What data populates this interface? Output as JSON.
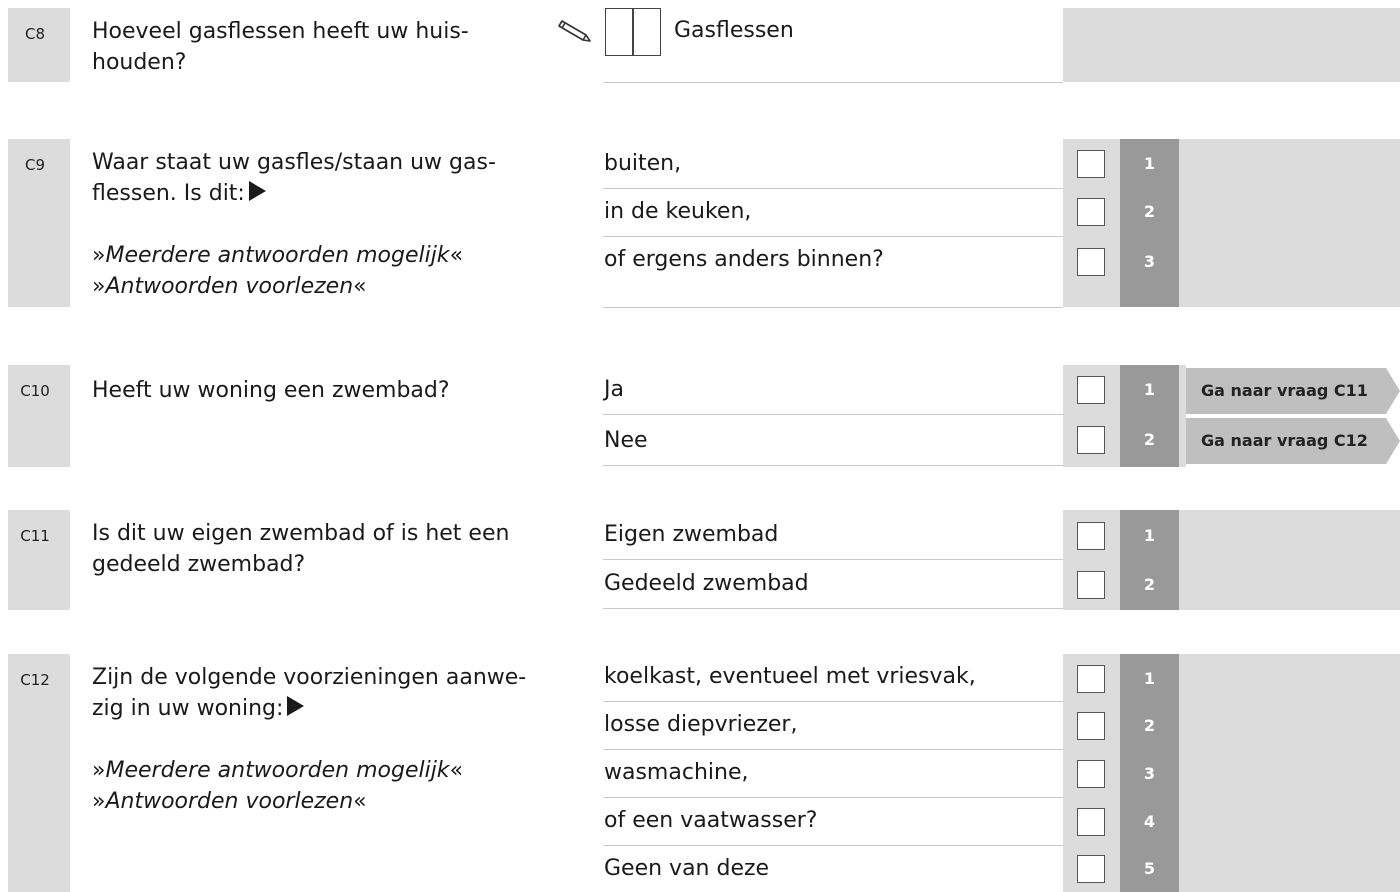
{
  "questions": [
    {
      "id": "C8",
      "text": "Hoeveel gasflessen heeft uw huis-houden?",
      "text_lines": [
        "Hoeveel gasflessen heeft uw huis-",
        "houden?"
      ],
      "input_unit": "Gasflessen",
      "input_icon": "pencil-icon"
    },
    {
      "id": "C9",
      "text_lines": [
        "Waar staat uw gasfles/staan uw gas-",
        "flessen. Is dit:"
      ],
      "notes": [
        "Meerdere antwoorden mogelijk",
        "Antwoorden voorlezen"
      ],
      "options": [
        {
          "label": "buiten,",
          "code": "1"
        },
        {
          "label": "in de keuken,",
          "code": "2"
        },
        {
          "label": "of ergens anders binnen?",
          "code": "3"
        }
      ]
    },
    {
      "id": "C10",
      "text_lines": [
        "Heeft uw woning een zwembad?"
      ],
      "options": [
        {
          "label": "Ja",
          "code": "1",
          "route": "Ga naar vraag C11"
        },
        {
          "label": "Nee",
          "code": "2",
          "route": "Ga naar vraag C12"
        }
      ]
    },
    {
      "id": "C11",
      "text_lines": [
        "Is dit uw eigen zwembad of is het een",
        "gedeeld zwembad?"
      ],
      "options": [
        {
          "label": "Eigen zwembad",
          "code": "1"
        },
        {
          "label": "Gedeeld zwembad",
          "code": "2"
        }
      ]
    },
    {
      "id": "C12",
      "text_lines": [
        "Zijn de volgende voorzieningen aanwe-",
        "zig in uw woning:"
      ],
      "notes": [
        "Meerdere antwoorden mogelijk",
        "Antwoorden voorlezen"
      ],
      "options": [
        {
          "label": "koelkast, eventueel met vriesvak,",
          "code": "1"
        },
        {
          "label": "losse diepvriezer,",
          "code": "2"
        },
        {
          "label": "wasmachine,",
          "code": "3"
        },
        {
          "label": "of een vaatwasser?",
          "code": "4"
        },
        {
          "label": "Geen van deze",
          "code": "5"
        }
      ]
    }
  ],
  "colors": {
    "panel": "#dcdcdc",
    "code_cell": "#999999",
    "route_cell": "#bfbfbf",
    "rule": "#c8c8c8"
  }
}
